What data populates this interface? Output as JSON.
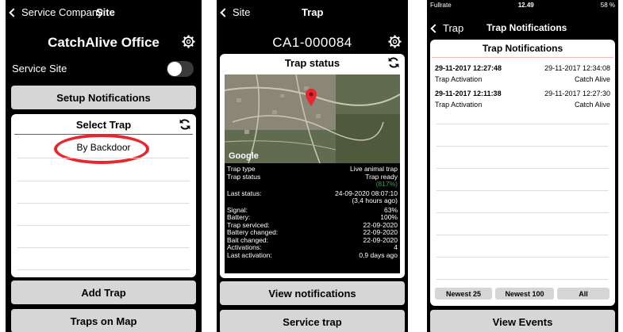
{
  "panel1": {
    "back_label": "Service Company",
    "header_title": "Site",
    "title": "CatchAlive Office",
    "service_site_label": "Service Site",
    "setup_notifications": "Setup Notifications",
    "select_trap_title": "Select Trap",
    "trap_items": [
      "By Backdoor"
    ],
    "add_trap": "Add Trap",
    "traps_on_map": "Traps on Map"
  },
  "panel2": {
    "back_label": "Site",
    "header_title": "Trap",
    "title": "CA1-000084",
    "card_title": "Trap status",
    "map_logo": "Google",
    "rows": [
      {
        "label": "Trap type",
        "value": "Live animal trap"
      },
      {
        "label": "Trap status",
        "value": "Trap ready"
      },
      {
        "label": "",
        "value": "(817%)"
      },
      {
        "label": "Last status:",
        "value": "24-09-2020 08:07:10"
      },
      {
        "label": "",
        "value": "(3,4 hours ago)"
      },
      {
        "label": "Signal:",
        "value": "63%"
      },
      {
        "label": "Battery:",
        "value": "100%"
      },
      {
        "label": "Trap serviced:",
        "value": "22-09-2020"
      },
      {
        "label": "Battery changed:",
        "value": "22-09-2020"
      },
      {
        "label": "Bait changed:",
        "value": "22-09-2020"
      },
      {
        "label": "Activations:",
        "value": "4"
      },
      {
        "label": "Last activation:",
        "value": "0,9 days ago"
      }
    ],
    "view_notifications": "View notifications",
    "service_trap": "Service trap"
  },
  "panel3": {
    "carrier": "Fullrate",
    "time": "12.49",
    "battery": "58 %",
    "back_label": "Trap",
    "header_title": "Trap Notifications",
    "card_title": "Trap Notifications",
    "notifications": [
      {
        "time1": "29-11-2017 12:27:48",
        "time2": "29-11-2017 12:34:08",
        "label1": "Trap Activation",
        "label2": "Catch Alive"
      },
      {
        "time1": "29-11-2017 12:11:38",
        "time2": "29-11-2017 12:27:30",
        "label1": "Trap Activation",
        "label2": "Catch Alive"
      }
    ],
    "newest25": "Newest 25",
    "newest100": "Newest 100",
    "all": "All",
    "view_events": "View Events"
  },
  "colors": {
    "accent_red": "#e8262e",
    "button_gray": "#d6d6d6",
    "status_green": "#2ea84a"
  }
}
